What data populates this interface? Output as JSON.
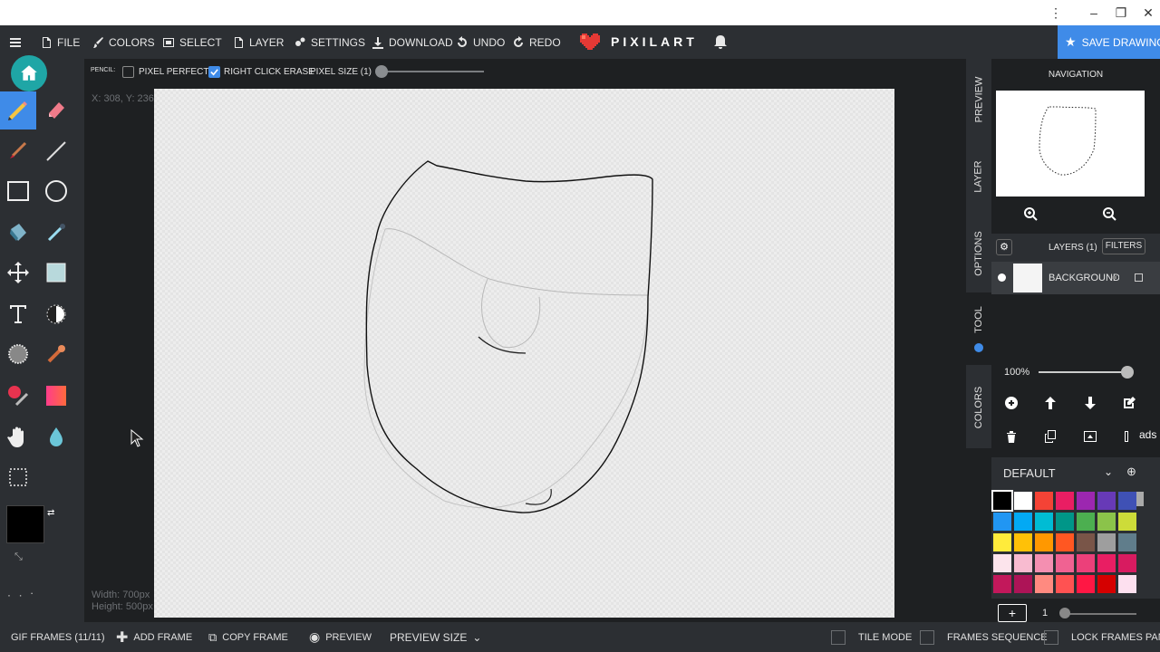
{
  "window": {
    "more_icon": "more-vertical-icon",
    "minimize_icon": "minimize-icon",
    "restore_icon": "restore-icon",
    "close_icon": "close-icon"
  },
  "menu": {
    "file": "FILE",
    "colors": "COLORS",
    "select": "SELECT",
    "layer": "LAYER",
    "settings": "SETTINGS",
    "download": "DOWNLOAD",
    "undo": "UNDO",
    "redo": "REDO",
    "logo": "PIXILART",
    "save": "SAVE DRAWING"
  },
  "options": {
    "tool_name": "PENCIL:",
    "pixel_perfect": "PIXEL PERFECT",
    "pixel_perfect_checked": false,
    "right_click_erase": "RIGHT CLICK ERASE",
    "right_click_erase_checked": true,
    "pixel_size": "PIXEL SIZE (1)",
    "pixel_size_value": 1
  },
  "canvas": {
    "cursor_coords": "X: 308, Y: 236",
    "width_label": "Width: 700px",
    "height_label": "Height: 500px"
  },
  "right_tabs": [
    "PREVIEW",
    "LAYER",
    "OPTIONS",
    "TOOL",
    "COLORS"
  ],
  "navigation": {
    "title": "NAVIGATION"
  },
  "layers": {
    "title": "LAYERS (1)",
    "filters": "FILTERS",
    "items": [
      {
        "name": "BACKGROUND"
      }
    ],
    "opacity": "100%",
    "opacity_value": 1.0
  },
  "palette": {
    "name": "DEFAULT",
    "colors": [
      "#000000",
      "#ffffff",
      "#f44336",
      "#e91e63",
      "#9c27b0",
      "#673ab7",
      "#3f51b5",
      "#2196f3",
      "#03a9f4",
      "#00bcd4",
      "#009688",
      "#4caf50",
      "#8bc34a",
      "#cddc39",
      "#ffeb3b",
      "#ffc107",
      "#ff9800",
      "#ff5722",
      "#795548",
      "#9e9e9e",
      "#607d8b",
      "#fce4ec",
      "#f8bbd0",
      "#f48fb1",
      "#f06292",
      "#ec407a",
      "#e91e63",
      "#d81b60",
      "#c2185b",
      "#ad1457",
      "#ff8a80",
      "#ff5252",
      "#ff1744",
      "#d50000",
      "#fde0ef"
    ]
  },
  "frames": {
    "gif_frames": "GIF FRAMES (11/11)",
    "add_frame": "ADD FRAME",
    "copy_frame": "COPY FRAME",
    "preview": "PREVIEW",
    "preview_size": "PREVIEW SIZE",
    "tile_mode": "TILE MODE",
    "frames_sequence": "FRAMES SEQUENCE",
    "lock_frames_panel": "LOCK FRAMES PANEL",
    "current_frame": "1"
  },
  "misc": {
    "ads_label": "ads"
  },
  "colors": {
    "primary": "#000000",
    "secondary": "#ffffff",
    "accent": "#3f8be8",
    "active_tool_bg": "#3f8be8"
  }
}
